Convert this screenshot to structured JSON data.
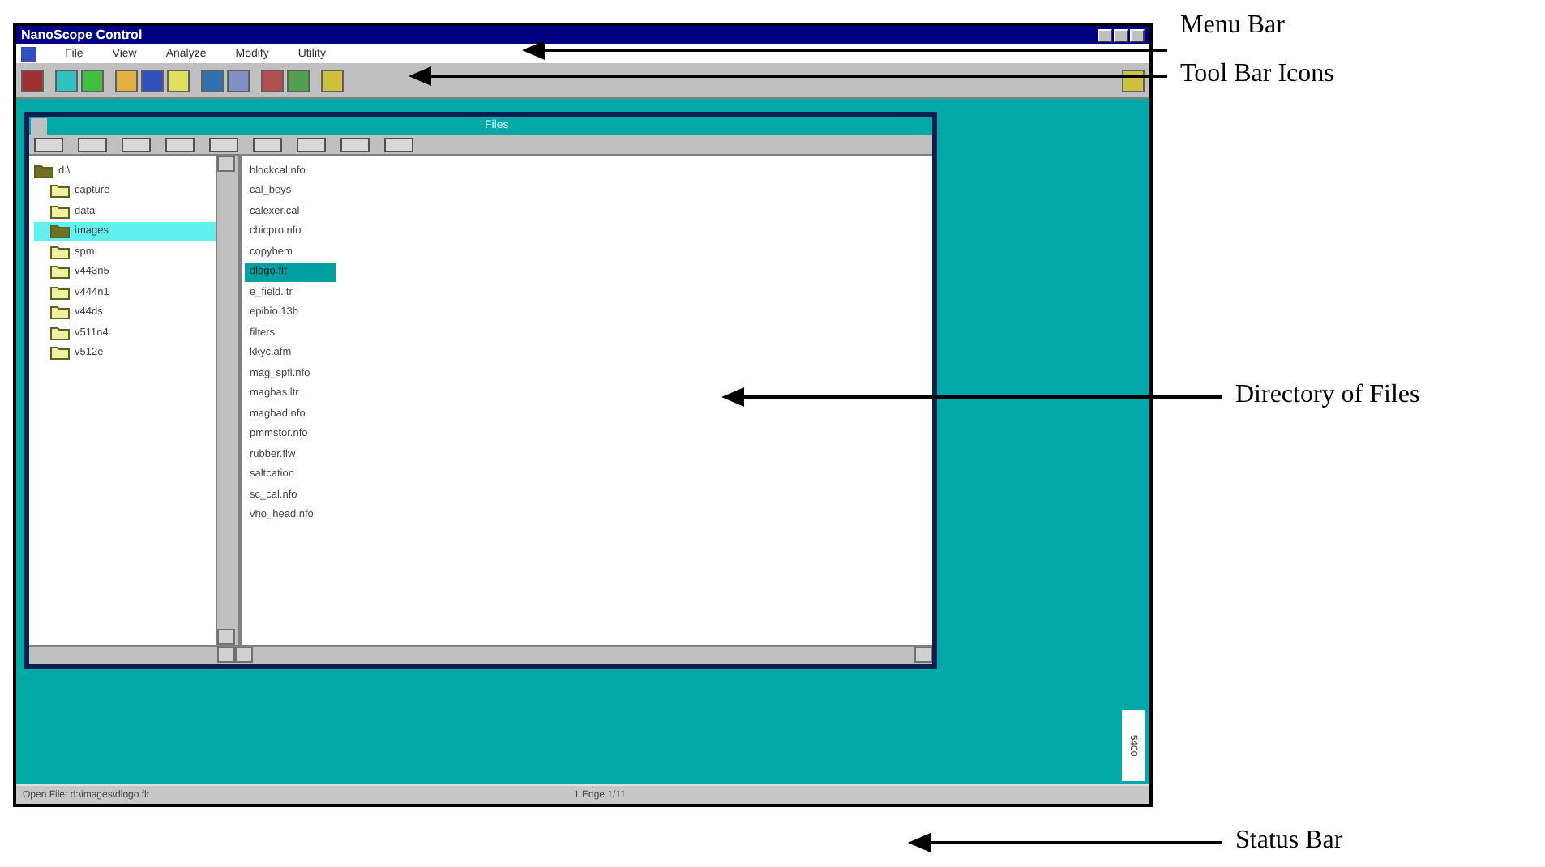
{
  "window": {
    "title": "NanoScope Control"
  },
  "menu": [
    "File",
    "View",
    "Analyze",
    "Modify",
    "Utility"
  ],
  "files_window": {
    "title": "Files"
  },
  "tree": {
    "label": "d:\\",
    "expanded": true,
    "children": [
      {
        "label": "capture",
        "selected": false
      },
      {
        "label": "data",
        "selected": false
      },
      {
        "label": "images",
        "selected": true
      },
      {
        "label": "spm",
        "selected": false
      },
      {
        "label": "v443n5",
        "selected": false
      },
      {
        "label": "v444n1",
        "selected": false
      },
      {
        "label": "v44ds",
        "selected": false
      },
      {
        "label": "v511n4",
        "selected": false
      },
      {
        "label": "v512e",
        "selected": false
      }
    ]
  },
  "files": [
    {
      "name": "blockcal.nfo",
      "selected": false
    },
    {
      "name": "cal_beys",
      "selected": false
    },
    {
      "name": "calexer.cal",
      "selected": false
    },
    {
      "name": "chicpro.nfo",
      "selected": false
    },
    {
      "name": "copybem",
      "selected": false
    },
    {
      "name": "dlogo.flt",
      "selected": true
    },
    {
      "name": "e_field.ltr",
      "selected": false
    },
    {
      "name": "epibio.13b",
      "selected": false
    },
    {
      "name": "filters",
      "selected": false
    },
    {
      "name": "kkyc.afm",
      "selected": false
    },
    {
      "name": "mag_spfl.nfo",
      "selected": false
    },
    {
      "name": "magbas.ltr",
      "selected": false
    },
    {
      "name": "magbad.nfo",
      "selected": false
    },
    {
      "name": "pmmstor.nfo",
      "selected": false
    },
    {
      "name": "rubber.flw",
      "selected": false
    },
    {
      "name": "saltcation",
      "selected": false
    },
    {
      "name": "sc_cal.nfo",
      "selected": false
    },
    {
      "name": "vho_head.nfo",
      "selected": false
    }
  ],
  "status_bar": {
    "left": "Open File:  d:\\images\\dlogo.flt",
    "center": "1 Edge 1/11"
  },
  "side_tag": "5400",
  "callouts": [
    {
      "label": "Menu Bar"
    },
    {
      "label": "Tool Bar Icons"
    },
    {
      "label": "Directory of Files"
    },
    {
      "label": "Status Bar"
    }
  ]
}
